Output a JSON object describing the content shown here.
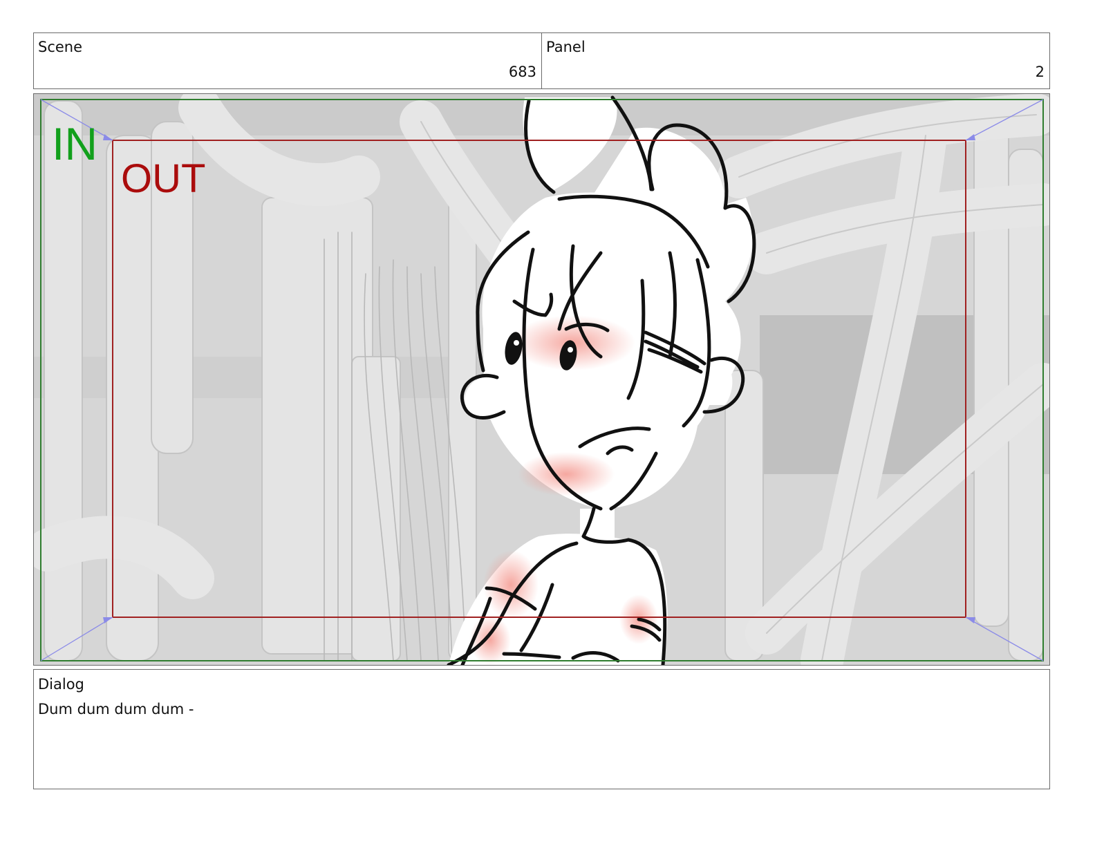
{
  "header": {
    "scene_label": "Scene",
    "scene_value": "683",
    "panel_label": "Panel",
    "panel_value": "2"
  },
  "frame": {
    "in_label": "IN",
    "out_label": "OUT",
    "in_color": "#12a01c",
    "out_color": "#aa0c0c"
  },
  "dialog": {
    "label": "Dialog",
    "text": "Dum dum dum dum -"
  }
}
